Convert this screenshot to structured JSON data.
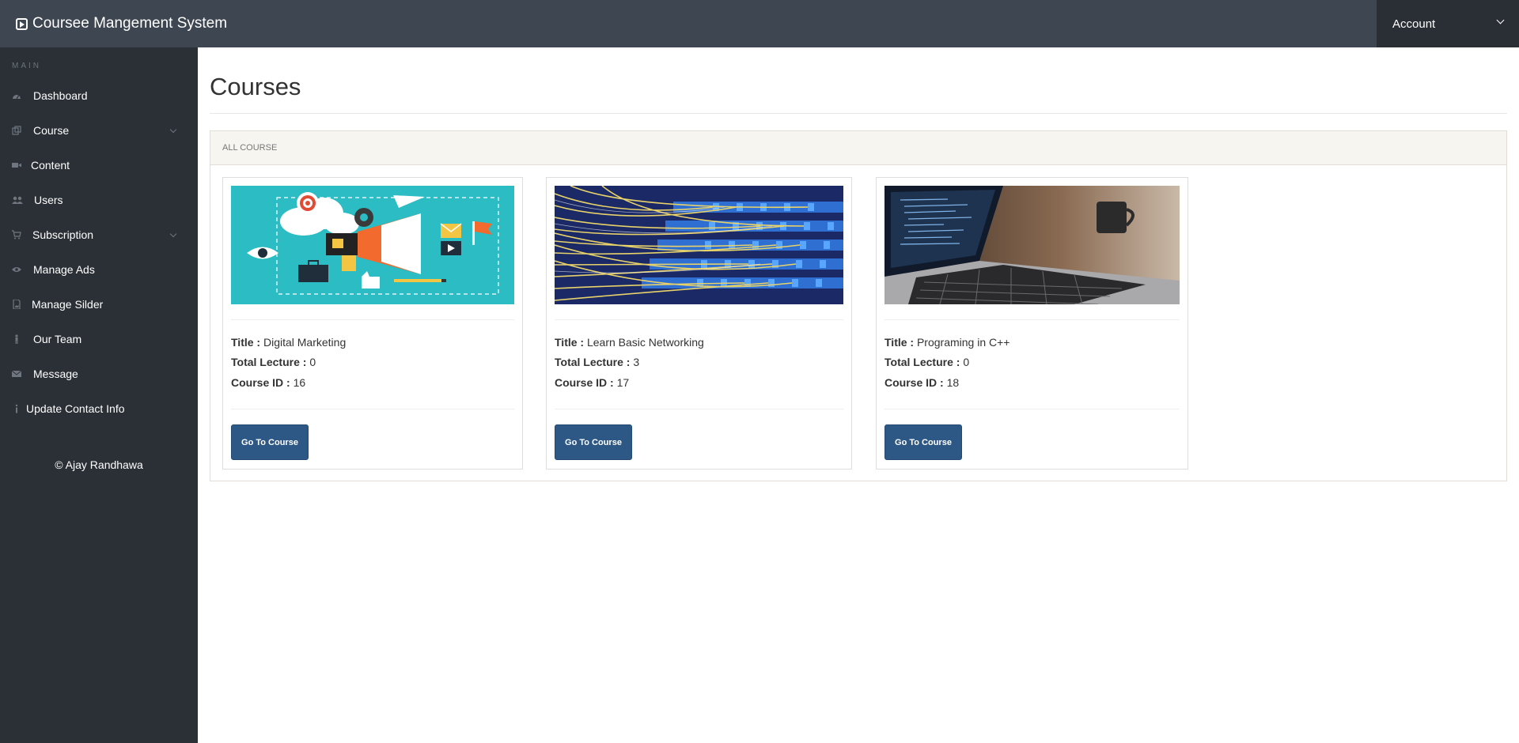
{
  "topbar": {
    "brand": "Coursee Mangement System",
    "account_label": "Account"
  },
  "sidebar": {
    "heading": "MAIN",
    "items": [
      {
        "label": "Dashboard",
        "icon": "dashboard-icon",
        "has_submenu": false
      },
      {
        "label": "Course",
        "icon": "course-icon",
        "has_submenu": true
      },
      {
        "label": "Content",
        "icon": "video-camera-icon",
        "has_submenu": false
      },
      {
        "label": "Users",
        "icon": "users-icon",
        "has_submenu": false
      },
      {
        "label": "Subscription",
        "icon": "cart-icon",
        "has_submenu": true
      },
      {
        "label": "Manage Ads",
        "icon": "eye-icon",
        "has_submenu": false
      },
      {
        "label": "Manage Silder",
        "icon": "image-file-icon",
        "has_submenu": false
      },
      {
        "label": "Our Team",
        "icon": "team-icon",
        "has_submenu": false
      },
      {
        "label": "Message",
        "icon": "envelope-icon",
        "has_submenu": false
      },
      {
        "label": "Update Contact Info",
        "icon": "info-icon",
        "has_submenu": false
      }
    ],
    "copyright": "© Ajay Randhawa"
  },
  "main": {
    "title": "Courses",
    "panel_heading": "ALL COURSE",
    "labels": {
      "title": "Title :",
      "total_lecture": "Total Lecture :",
      "course_id": "Course ID :"
    },
    "courses": [
      {
        "title": "Digital Marketing",
        "total_lecture": "0",
        "course_id": "16",
        "button": "Go To Course",
        "image": "digital-marketing-illustration"
      },
      {
        "title": "Learn Basic Networking",
        "total_lecture": "3",
        "course_id": "17",
        "button": "Go To Course",
        "image": "network-cables-photo"
      },
      {
        "title": "Programing in C++",
        "total_lecture": "0",
        "course_id": "18",
        "button": "Go To Course",
        "image": "laptop-code-photo"
      }
    ]
  }
}
